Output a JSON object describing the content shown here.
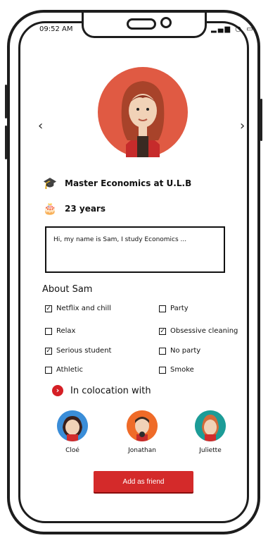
{
  "status": {
    "time": "09:52 AM",
    "icons": [
      "signal-icon",
      "wifi-icon",
      "battery-icon"
    ]
  },
  "profile": {
    "education": "Master Economics at U.L.B",
    "age": "23 years",
    "bio": "Hi, my name is Sam, I study Economics ...",
    "prev_arrow": "‹",
    "next_arrow": "›"
  },
  "about": {
    "title": "About Sam",
    "options": [
      {
        "label": "Netflix and chill",
        "checked": true
      },
      {
        "label": "Party",
        "checked": false
      },
      {
        "label": "Relax",
        "checked": false
      },
      {
        "label": "Obsessive cleaning",
        "checked": true
      },
      {
        "label": "Serious student",
        "checked": true
      },
      {
        "label": "No party",
        "checked": false
      },
      {
        "label": "Athletic",
        "checked": false
      },
      {
        "label": "Smoke",
        "checked": false
      }
    ]
  },
  "coloc": {
    "title": "In colocation with",
    "friends": [
      {
        "name": "Cloé"
      },
      {
        "name": "Jonathan"
      },
      {
        "name": "Juliette"
      }
    ]
  },
  "actions": {
    "add_friend": "Add as friend"
  },
  "colors": {
    "accent": "#d42a2a",
    "avatar_bg": "#e05a43",
    "hair": "#a8432a"
  }
}
